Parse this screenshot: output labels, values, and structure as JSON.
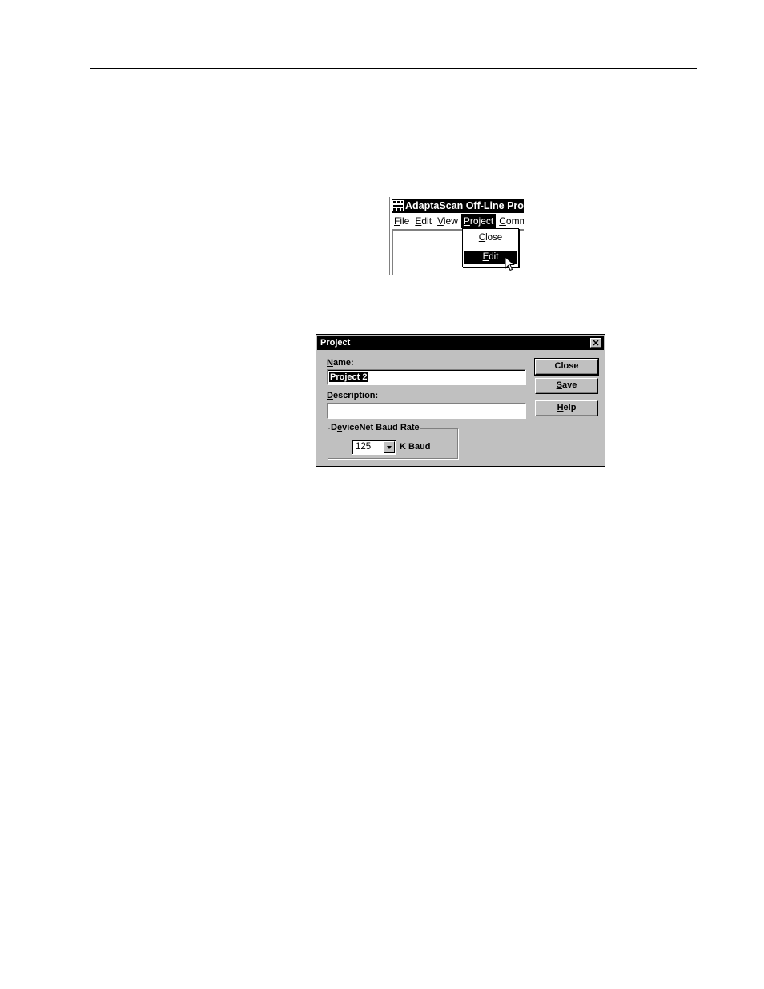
{
  "menu_snippet": {
    "window_title": "AdaptaScan Off-Line Progr",
    "menubar": [
      {
        "label": "File",
        "mnemonic_index": 0,
        "active": false
      },
      {
        "label": "Edit",
        "mnemonic_index": 0,
        "active": false
      },
      {
        "label": "View",
        "mnemonic_index": 0,
        "active": false
      },
      {
        "label": "Project",
        "mnemonic_index": 0,
        "active": true
      },
      {
        "label": "Comm",
        "mnemonic_index": 0,
        "active": false
      }
    ],
    "dropdown": {
      "close_label": "Close",
      "edit_label": "Edit",
      "selected": "Edit"
    }
  },
  "dialog": {
    "title": "Project",
    "name_label": "Name:",
    "name_value": "Project 2",
    "description_label": "Description:",
    "description_value": "",
    "group_title": "DeviceNet Baud Rate",
    "baud_value": "125",
    "baud_unit": "K Baud",
    "buttons": {
      "close": "Close",
      "save": "Save",
      "help": "Help"
    }
  },
  "icons": [
    "app-icon",
    "close-x-icon",
    "dropdown-arrow-icon",
    "mouse-cursor-icon"
  ]
}
